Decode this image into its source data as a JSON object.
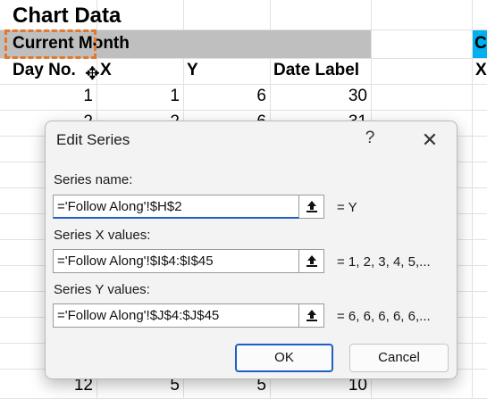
{
  "sheet": {
    "title": "Chart Data",
    "section_left": "Current Month",
    "section_right": "C",
    "headers": {
      "day_no": "Day No.",
      "x": "X",
      "y": "Y",
      "date_label": "Date Label",
      "x_right": "X"
    },
    "rows": [
      {
        "day": "1",
        "x": "1",
        "y": "6",
        "date": "30"
      },
      {
        "day": "2",
        "x": "2",
        "y": "6",
        "date": "31"
      },
      {
        "day": "12",
        "x": "5",
        "y": "5",
        "date": "10"
      }
    ]
  },
  "dialog": {
    "title": "Edit Series",
    "help": "?",
    "close": "✕",
    "series_name_label": "Series name:",
    "series_name_value": "='Follow Along'!$H$2",
    "series_name_preview": "= Y",
    "series_x_label": "Series X values:",
    "series_x_value": "='Follow Along'!$I$4:$I$45",
    "series_x_preview": "= 1, 2, 3, 4, 5,...",
    "series_y_label": "Series Y values:",
    "series_y_value": "='Follow Along'!$J$4:$J$45",
    "series_y_preview": "= 6, 6, 6, 6, 6,...",
    "ok_label": "OK",
    "cancel_label": "Cancel"
  },
  "colors": {
    "accent": "#1f5fbf",
    "section_band": "#bfbfbf",
    "right_band": "#00b0f0",
    "selection": "#e7772a"
  }
}
